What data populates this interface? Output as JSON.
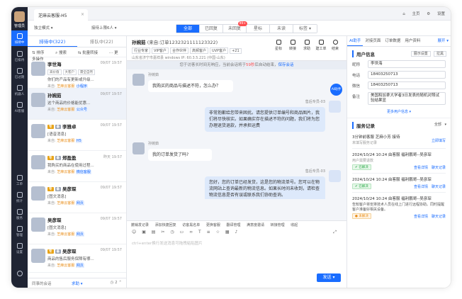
{
  "rail": {
    "role": "管理员",
    "nav": [
      {
        "label": "排待中",
        "icon": "chat-icon",
        "active": true
      },
      {
        "label": "已排待",
        "icon": "history-icon",
        "active": false
      },
      {
        "label": "已过期",
        "icon": "clock-icon",
        "active": false
      },
      {
        "label": "机器人",
        "icon": "robot-icon",
        "active": false
      },
      {
        "label": "AI客服",
        "icon": "ai-icon",
        "active": false
      },
      {
        "label": "工单",
        "icon": "ticket-icon",
        "active": false
      },
      {
        "label": "统计",
        "icon": "stats-icon",
        "active": false
      },
      {
        "label": "服务",
        "icon": "service-icon",
        "active": false
      },
      {
        "label": "管理",
        "icon": "manage-icon",
        "active": false
      },
      {
        "label": "设置",
        "icon": "settings-icon",
        "active": false
      }
    ]
  },
  "window_tab": {
    "title": "芝麻云客服-H5"
  },
  "topright": {
    "home": "主页",
    "settings": "设置"
  },
  "filters": {
    "mode": "独立模式",
    "range": "接待上限6人"
  },
  "status_tabs": [
    {
      "label": "全部",
      "on": true
    },
    {
      "label": "已回复",
      "on": false
    },
    {
      "label": "未回复",
      "on": false,
      "badge": "99+"
    },
    {
      "label": "星标",
      "on": false
    },
    {
      "label": "未读",
      "on": false
    },
    {
      "label": "标签",
      "on": false
    }
  ],
  "list": {
    "tabs": [
      {
        "label": "排待中(322)",
        "on": true
      },
      {
        "label": "排队中(22)",
        "on": false
      }
    ],
    "tools": [
      "排序",
      "搜索",
      "批量转接",
      "更多操作"
    ],
    "items": [
      {
        "name": "李世海",
        "time": "09/07 19:57",
        "chips": [
          "高价值",
          "大客户",
          "需全自然"
        ],
        "preview": "你们的产品有更新或升级...",
        "source": "芝麻云客服",
        "source_tag": "小程序",
        "selected": false
      },
      {
        "name": "孙婉茹",
        "time": "09/07 19:57",
        "chips": [],
        "preview": "这个商品的价格能优惠...",
        "source": "芝麻云客服",
        "source_tag": "公众号",
        "selected": true
      },
      {
        "name": "李雅卓",
        "time": "09/07 19:57",
        "tags": [
          "专",
          "备"
        ],
        "preview": "[语音消息]",
        "source": "芝麻云客服",
        "source_tag": "H5",
        "selected": false
      },
      {
        "name": "郑盈盈",
        "time": "昨天 19:57",
        "tags": [
          "专",
          "备"
        ],
        "preview": "我购买的商品在使用过程...",
        "source": "芝麻云客服",
        "source_tag": "微信客服",
        "selected": false
      },
      {
        "name": "吴彦琛",
        "time": "09/07 19:57",
        "tags": [
          "专",
          "备"
        ],
        "preview": "[图文消息]",
        "source": "芝麻云客服",
        "source_tag": "网页",
        "selected": false
      },
      {
        "name": "吴彦琛",
        "time": "09/07 19:57",
        "tags": [],
        "preview": "[图文消息]",
        "source": "芝麻云客服",
        "source_tag": "网页",
        "selected": false
      },
      {
        "name": "吴彦琛",
        "time": "09/07 19:57",
        "tags": [
          "专",
          "备"
        ],
        "preview": "商品的售后服务保障有哪...",
        "source": "芝麻云客服",
        "source_tag": "网页",
        "selected": false
      }
    ],
    "footer": {
      "left": "同事的会话",
      "right": "求助",
      "count": "2"
    }
  },
  "chat": {
    "name": "孙婉茹",
    "subtitle": "(来自:订单1232321111123322)",
    "tags": [
      "行业专家",
      "VIP客户",
      "合作伙伴",
      "高频客户",
      "UVP客户",
      "+21"
    ],
    "meta": "山东省济宁市嘉祥县   windows   IP: 60.3.5.221 (中国-山东)",
    "actions": [
      "星标",
      "转接",
      "求助",
      "建工单",
      "结束"
    ],
    "notice": {
      "before": "您于访客长时间无响应，当前会话将于",
      "count": "59秒",
      "after": "后自动结束，",
      "link": "保存会话"
    },
    "messages": [
      {
        "side": "l",
        "who": "孙婉茹",
        "text": "我购买的商品与描述不符，怎么办？"
      },
      {
        "side": "r",
        "who": "售后专员-03",
        "text": "非常抱歉给您带来困扰。请您提供订单编号和商品图片，我们将尽快核实。如果确实存在描述不符的问题，我们将为您办理退货退款，并承担运费"
      },
      {
        "side": "l",
        "who": "孙婉茹",
        "text": "我的订单发货了吗?"
      },
      {
        "side": "r",
        "who": "售后专员-03",
        "text": "您好，您的订单已经发货，这是您的物流单号。您可以在物流网站上查询最新的物流信息。如果长时间未收到，请检查物流信息是否有误或联系我们协助查询。"
      }
    ],
    "ai_label": "AI助手",
    "toolbar": [
      "撤销发记录",
      "添加快捷回复",
      "访客黑名单",
      "更换客服",
      "翻译管理",
      "满意度邀请",
      "转接管理",
      "收起"
    ],
    "input_placeholder": "ctrl+enter换行发送消息可拖拽粘贴图片",
    "send": "发送"
  },
  "right": {
    "tabs": [
      {
        "label": "AI助手",
        "on": true
      },
      {
        "label": "对接页面",
        "on": false
      },
      {
        "label": "订单数据",
        "on": false
      },
      {
        "label": "用户资料",
        "on": false
      }
    ],
    "expand": "展开",
    "user": {
      "title": "用户信息",
      "btn1": "展示设置",
      "btn2": "拉黑",
      "fields": [
        {
          "k": "昵称",
          "v": "李世海"
        },
        {
          "k": "电话",
          "v": "18403250713"
        },
        {
          "k": "微信",
          "v": "18403250713"
        },
        {
          "k": "备注",
          "v": "美国和加拿大学者3日发表的随机对照试验结果显"
        }
      ],
      "more": "更多用户信息"
    },
    "records": {
      "title": "服务记录",
      "filter": "全部",
      "head": "3分钟前客服 芝麻小芳 接待",
      "head_sub": "未填写服务记录",
      "head_link": "立即填写",
      "items": [
        {
          "title": "2024/10/24 10:24 由客服 福利鹏哥--吴彦琛",
          "sub": "用户需要退款",
          "status": "已解决",
          "ok": true,
          "ops": [
            "查看详情",
            "聊天记录"
          ]
        },
        {
          "title": "2024/10/24 10:24 由客服 福利鹏哥--吴彦琛",
          "sub": "",
          "status": "已解决",
          "ok": true,
          "ops": [
            "查看详情",
            "聊天记录"
          ]
        },
        {
          "title": "2024/10/24 10:24 由客服 福利鹏哥--吴彦琛",
          "sub": "告知客户将安排技术人员在线上门进行远程协助。同时提醒客户准备好相关设备。",
          "status": "未解决",
          "ok": false,
          "ops": [
            "查看详情",
            "聊天记录"
          ]
        }
      ]
    }
  }
}
